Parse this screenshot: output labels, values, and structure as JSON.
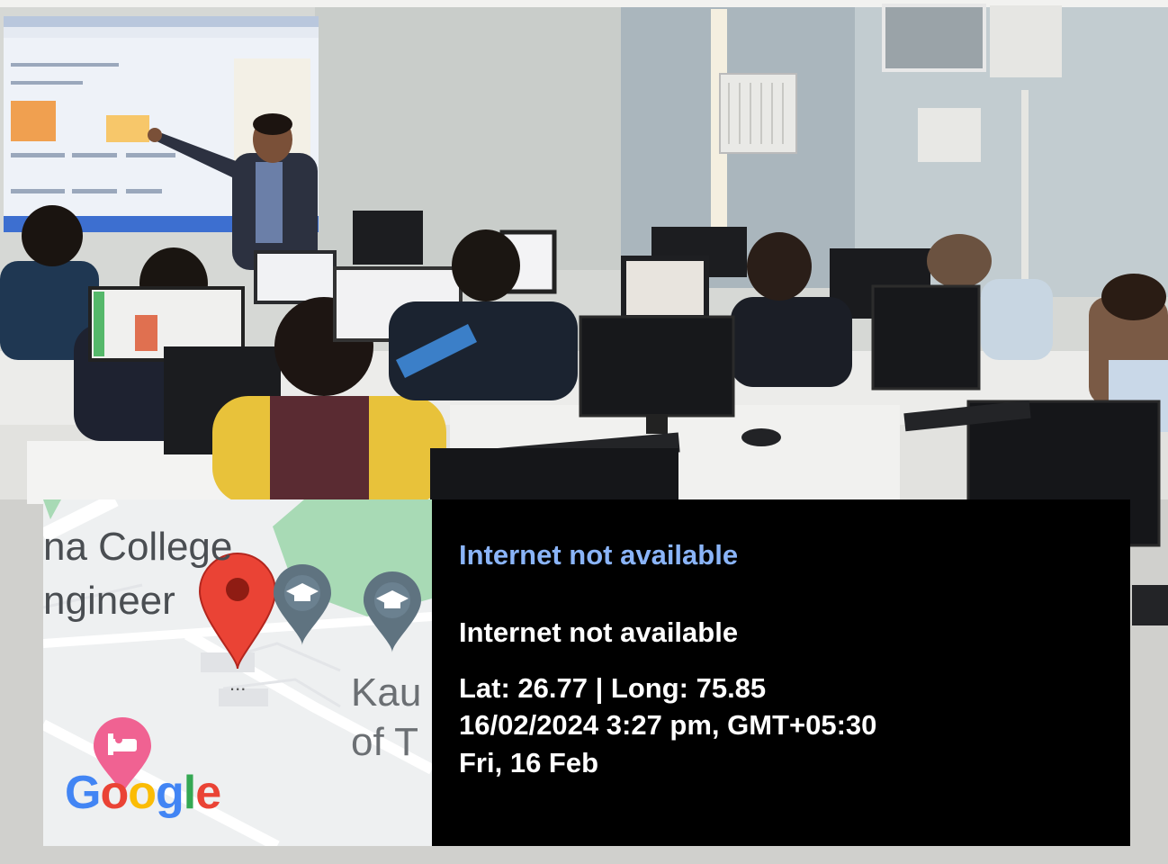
{
  "map": {
    "label_1": "na College",
    "label_2": "ngineer",
    "label_3": "Kau",
    "label_4": "of T",
    "pin_dots": "...",
    "logo_letters": [
      "G",
      "o",
      "o",
      "g",
      "l",
      "e"
    ],
    "logo_colors": [
      "#4285F4",
      "#EA4335",
      "#FBBC05",
      "#4285F4",
      "#34A853",
      "#EA4335"
    ],
    "pin_color": "#EA4335",
    "school_marker_color": "#5f7380",
    "hotel_marker_color": "#f06292",
    "park_color": "#a8dab5"
  },
  "info": {
    "heading": "Internet not available",
    "address": "Internet not available",
    "coords": "Lat: 26.77 | Long: 75.85",
    "datetime": "16/02/2024  3:27 pm, GMT+05:30",
    "day": "Fri, 16 Feb",
    "heading_color": "#8ab4f8"
  }
}
